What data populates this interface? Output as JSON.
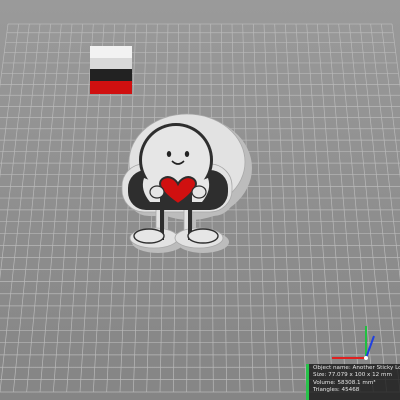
{
  "colors": {
    "background": "#8e8e8e",
    "grid": "#b9b9b9",
    "model_body": "#e0e0e0",
    "model_face": "#2e2e2e",
    "heart": "#d01010",
    "accent": "#27c24a",
    "axis_x": "#e02020",
    "axis_y": "#20c040",
    "axis_z": "#2040e0"
  },
  "icons": {
    "filament_swatch": "color-swatch-icon",
    "axis_gizmo": "axes-icon"
  },
  "object_info": {
    "name_line": "Object name: Another Sticky Love",
    "size_line": "Size: 77.079 x 100 x 12 mm",
    "volume_line": "Volume: 58308.1 mm³",
    "triangles_line": "Triangles: 45468"
  }
}
